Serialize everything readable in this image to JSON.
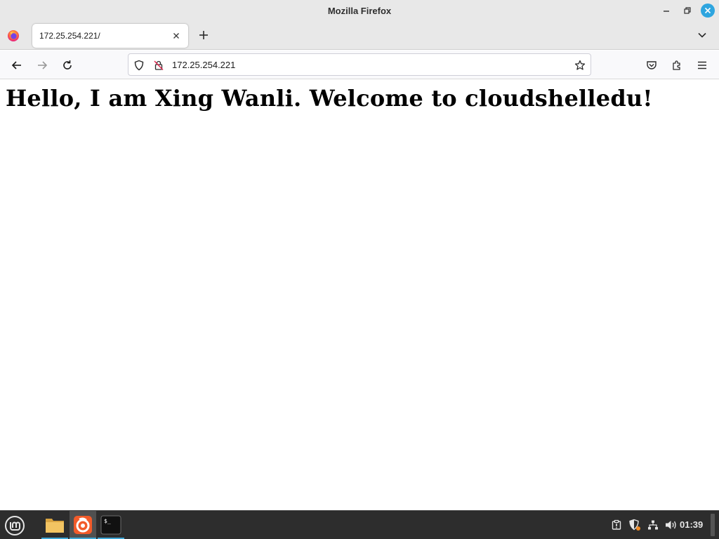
{
  "window": {
    "title": "Mozilla Firefox",
    "controls": [
      "minimize-icon",
      "restore-icon",
      "close-icon"
    ],
    "accent_color": "#2ea5df"
  },
  "tabs": [
    {
      "title": "172.25.254.221/",
      "active": true,
      "icon": "firefox-icon"
    }
  ],
  "navbar": {
    "url": "172.25.254.221",
    "icons": [
      "back-icon",
      "forward-icon",
      "reload-icon",
      "shield-icon",
      "insecure-lock-icon",
      "bookmark-star-icon",
      "pocket-icon",
      "extensions-icon",
      "menu-icon"
    ]
  },
  "page": {
    "heading": "Hello, I am Xing Wanli. Welcome to cloudshelledu!"
  },
  "taskbar": {
    "apps": [
      "files-app-icon",
      "firefox-app-icon",
      "terminal-app-icon"
    ],
    "active_app": "firefox-app-icon",
    "tray_icons": [
      "update-manager-icon",
      "security-shield-icon",
      "network-icon",
      "volume-icon"
    ],
    "clock": "01:39",
    "background_color": "#2d2d2d"
  }
}
